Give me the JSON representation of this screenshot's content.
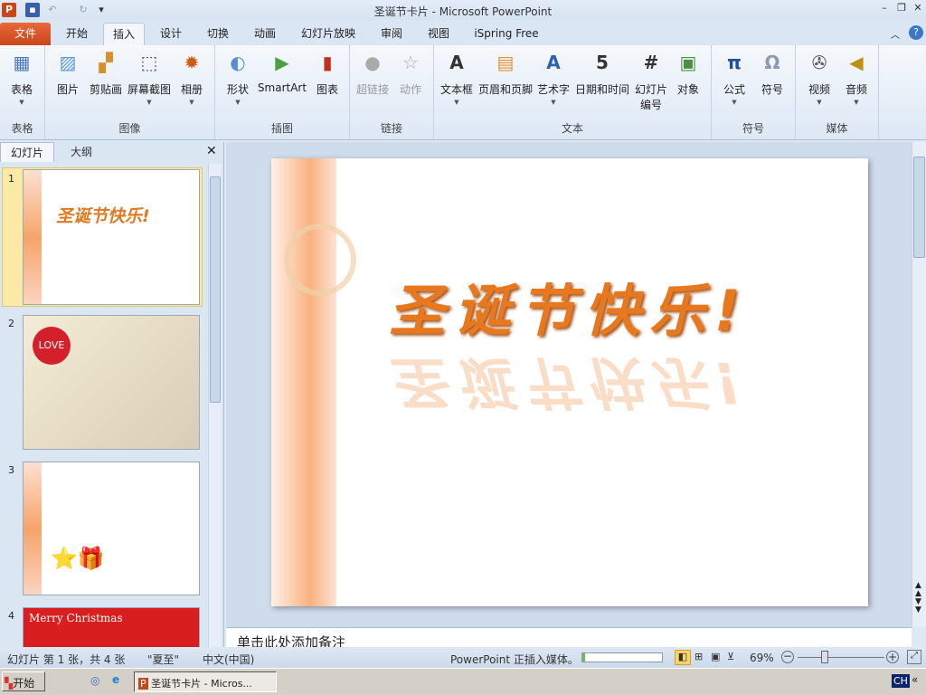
{
  "window": {
    "title": "圣诞节卡片 - Microsoft PowerPoint",
    "app_icon": "P"
  },
  "tabs": [
    "文件",
    "开始",
    "插入",
    "设计",
    "切换",
    "动画",
    "幻灯片放映",
    "审阅",
    "视图",
    "iSpring Free"
  ],
  "ribbon": {
    "groups": [
      {
        "label": "表格",
        "buttons": [
          {
            "label": "表格",
            "icon": "table-icon"
          }
        ]
      },
      {
        "label": "图像",
        "buttons": [
          {
            "label": "图片",
            "icon": "picture-icon"
          },
          {
            "label": "剪贴画",
            "icon": "clipart-icon"
          },
          {
            "label": "屏幕截图",
            "icon": "screenshot-icon"
          },
          {
            "label": "相册",
            "icon": "photo-album-icon"
          }
        ]
      },
      {
        "label": "插图",
        "buttons": [
          {
            "label": "形状",
            "icon": "shapes-icon"
          },
          {
            "label": "SmartArt",
            "icon": "smartart-icon"
          },
          {
            "label": "图表",
            "icon": "chart-icon"
          }
        ]
      },
      {
        "label": "链接",
        "buttons": [
          {
            "label": "超链接",
            "icon": "hyperlink-icon"
          },
          {
            "label": "动作",
            "icon": "action-icon"
          }
        ]
      },
      {
        "label": "文本",
        "buttons": [
          {
            "label": "文本框",
            "icon": "textbox-icon"
          },
          {
            "label": "页眉和页脚",
            "icon": "header-footer-icon"
          },
          {
            "label": "艺术字",
            "icon": "wordart-icon"
          },
          {
            "label": "日期和时间",
            "icon": "datetime-icon"
          },
          {
            "label": "幻灯片编号",
            "icon": "slide-number-icon"
          },
          {
            "label": "对象",
            "icon": "object-icon"
          }
        ]
      },
      {
        "label": "符号",
        "buttons": [
          {
            "label": "公式",
            "icon": "equation-icon"
          },
          {
            "label": "符号",
            "icon": "symbol-icon"
          }
        ]
      },
      {
        "label": "媒体",
        "buttons": [
          {
            "label": "视频",
            "icon": "video-icon"
          },
          {
            "label": "音频",
            "icon": "audio-icon"
          }
        ]
      }
    ]
  },
  "panel": {
    "tabs": [
      "幻灯片",
      "大纲"
    ],
    "slides": [
      "1",
      "2",
      "3",
      "4"
    ],
    "thumb1_title": "圣诞节快乐!",
    "thumb2_text": "LOVE",
    "thumb4_text": "Merry Christmas"
  },
  "slide": {
    "title": "圣诞节快乐!"
  },
  "notes": {
    "placeholder": "单击此处添加备注"
  },
  "status": {
    "slide_info": "幻灯片 第 1 张，共 4 张",
    "theme": "\"夏至\"",
    "language": "中文(中国)",
    "progress_text": "PowerPoint 正插入媒体。",
    "progress": 0.03,
    "zoom": "69%"
  },
  "taskbar": {
    "start": "开始",
    "window": "圣诞节卡片 - Micros...",
    "ime": "CH"
  }
}
